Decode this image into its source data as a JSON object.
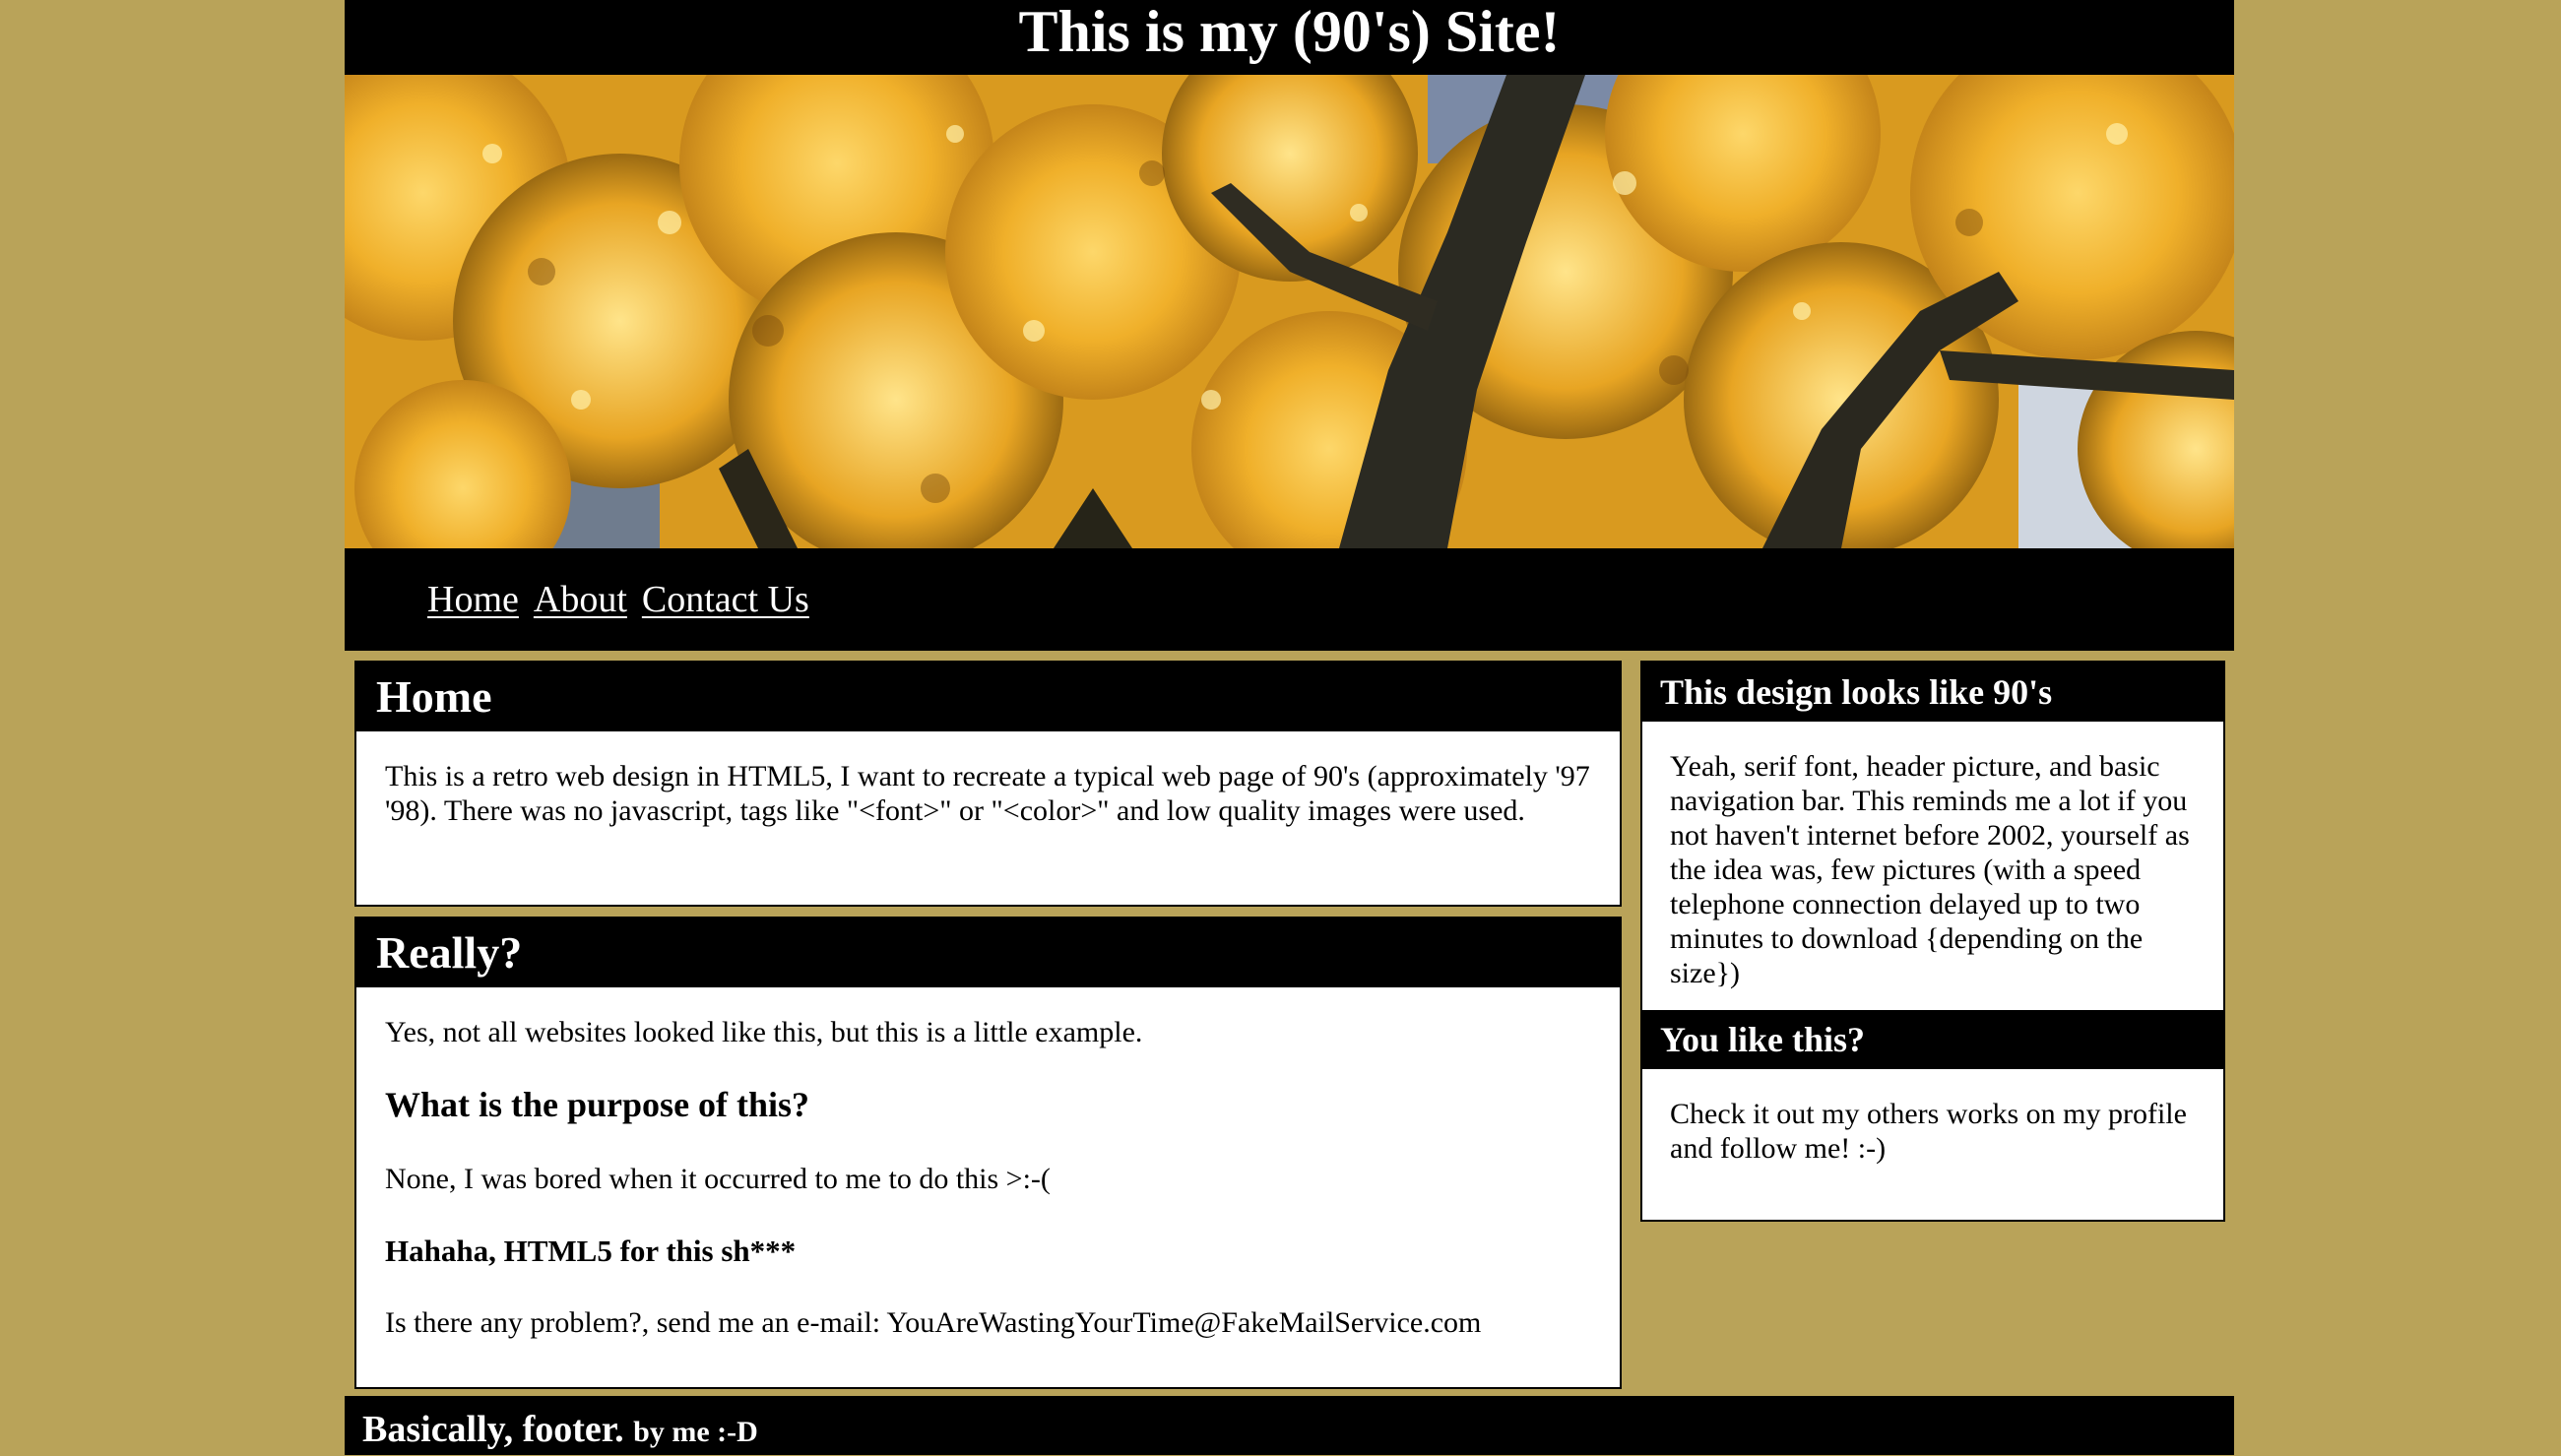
{
  "header": {
    "title": "This is my (90's) Site!"
  },
  "banner": {
    "description_icon": "autumn-tree-photo"
  },
  "nav": {
    "items": [
      {
        "label": "Home"
      },
      {
        "label": "About"
      },
      {
        "label": "Contact Us"
      }
    ]
  },
  "main": {
    "home": {
      "heading": "Home",
      "text": "This is a retro web design in HTML5, I want to recreate a typical web page of 90's (approximately '97 '98). There was no javascript, tags like \"<font>\" or \"<color>\" and low quality images were used."
    },
    "really": {
      "heading": "Really?",
      "intro": "Yes, not all websites looked like this, but this is a little example.",
      "question": "What is the purpose of this?",
      "answer": "None, I was bored when it occurred to me to do this >:-(",
      "bold_line": "Hahaha, HTML5 for this sh***",
      "contact": "Is there any problem?, send me an e-mail: YouAreWastingYourTime@FakeMailService.com"
    }
  },
  "sidebar": {
    "design": {
      "heading": "This design looks like 90's",
      "text": "Yeah, serif font, header picture, and basic navigation bar. This reminds me a lot if you not haven't internet before 2002, yourself as the idea was, few pictures (with a speed telephone connection delayed up to two minutes to download {depending on the size})"
    },
    "like": {
      "heading": "You like this?",
      "text": "Check it out my others works on my profile and follow me! :-)"
    }
  },
  "footer": {
    "main": "Basically, footer.",
    "small": "by me :-D"
  },
  "colors": {
    "background": "#b9a359",
    "bars": "#000000",
    "panel": "#ffffff",
    "foliage": "#e4a41c"
  }
}
